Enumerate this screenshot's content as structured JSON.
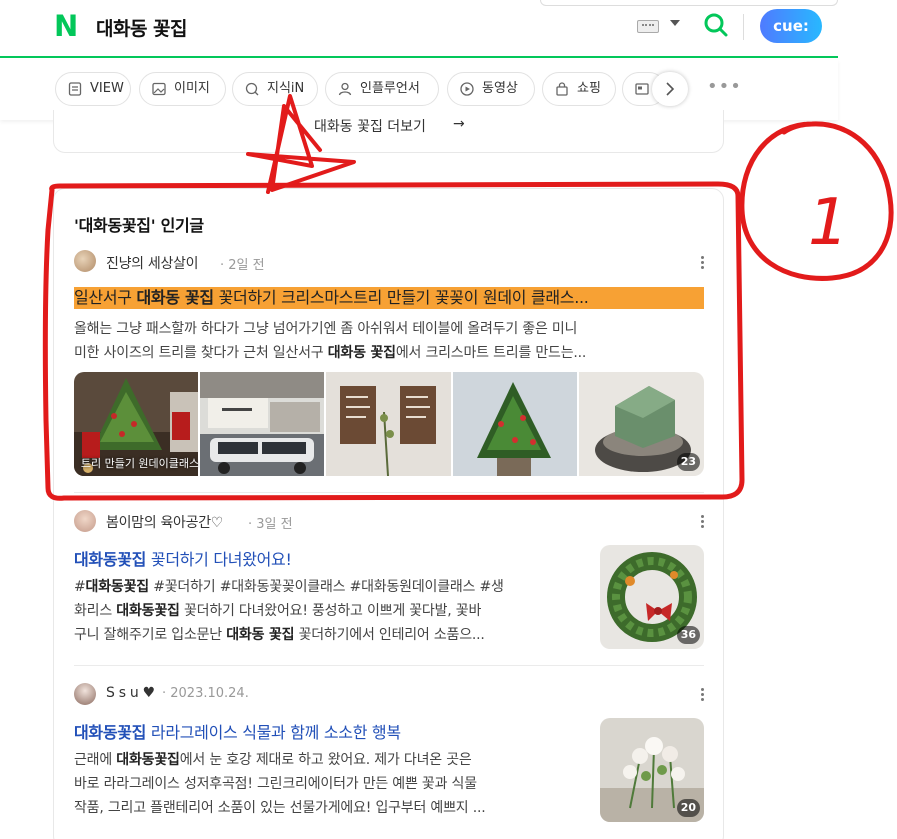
{
  "header": {
    "logo": "N",
    "title": "대화동 꽃집",
    "cue_label": "cue:"
  },
  "tabs": [
    {
      "label": "VIEW",
      "icon": "document-icon"
    },
    {
      "label": "이미지",
      "icon": "image-icon"
    },
    {
      "label": "지식iN",
      "icon": "search-bubble-icon"
    },
    {
      "label": "인플루언서",
      "icon": "person-icon"
    },
    {
      "label": "동영상",
      "icon": "play-icon"
    },
    {
      "label": "쇼핑",
      "icon": "bag-icon"
    }
  ],
  "more_link": {
    "label": "대화동 꽃집 더보기",
    "arrow": "→"
  },
  "section": {
    "title": "'대화동꽃집' 인기글"
  },
  "posts": [
    {
      "author": "진냥의 세상살이",
      "date": "2일 전",
      "title_pre": "일산서구 ",
      "title_bold": "대화동 꽃집",
      "title_post": " 꽃더하기 크리스마스트리 만들기 꽃꽂이 원데이 클래스...",
      "snippet_line1": "올해는 그냥 패스할까 하다가 그냥 넘어가기엔 좀 아쉬워서 테이블에 올려두기 좋은 미니",
      "snippet_line2_pre": "미한 사이즈의 트리를 찾다가 근처 일산서구 ",
      "snippet_line2_bold": "대화동 꽃집",
      "snippet_line2_post": "에서 크리스마트 트리를 만드는...",
      "thumb_caption": "트리 만들기 원데이클래스",
      "image_count": "23"
    },
    {
      "author": "봄이맘의 육아공간♡",
      "date": "3일 전",
      "title_bold": "대화동꽃집",
      "title_post": " 꽃더하기 다녀왔어요!",
      "snippet_line1_pre": "#",
      "snippet_line1_bold": "대화동꽃집",
      "snippet_line1_post": " #꽃더하기 #대화동꽃꽂이클래스 #대화동원데이클래스 #생",
      "snippet_line2_pre": "화리스 ",
      "snippet_line2_bold": "대화동꽃집",
      "snippet_line2_post": " 꽃더하기 다녀왔어요! 풍성하고 이쁘게 꽃다발, 꽃바",
      "snippet_line3_pre": "구니 잘해주기로 입소문난 ",
      "snippet_line3_bold": "대화동 꽃집",
      "snippet_line3_post": " 꽃더하기에서 인테리어 소품으...",
      "image_count": "36"
    },
    {
      "author": "S s u ♥",
      "date": "2023.10.24.",
      "title_bold": "대화동꽃집",
      "title_post": " 라라그레이스 식물과 함께 소소한 행복",
      "snippet_line1_pre": "근래에 ",
      "snippet_line1_bold": "대화동꽃집",
      "snippet_line1_post": "에서 눈 호강 제대로 하고 왔어요. 제가 다녀온 곳은",
      "snippet_line2": "바로 라라그레이스 성저후곡점! 그린크리에이터가 만든 예쁜 꽃과 식물",
      "snippet_line3": "작품, 그리고 플랜테리어 소품이 있는 선물가게에요! 입구부터 예쁘지 ...",
      "image_count": "20"
    }
  ],
  "annotation": {
    "label": "1",
    "color": "#e21b1b"
  },
  "colors": {
    "brand_green": "#03c75a",
    "link_blue": "#2250b8",
    "highlight_orange": "#f7a134"
  }
}
